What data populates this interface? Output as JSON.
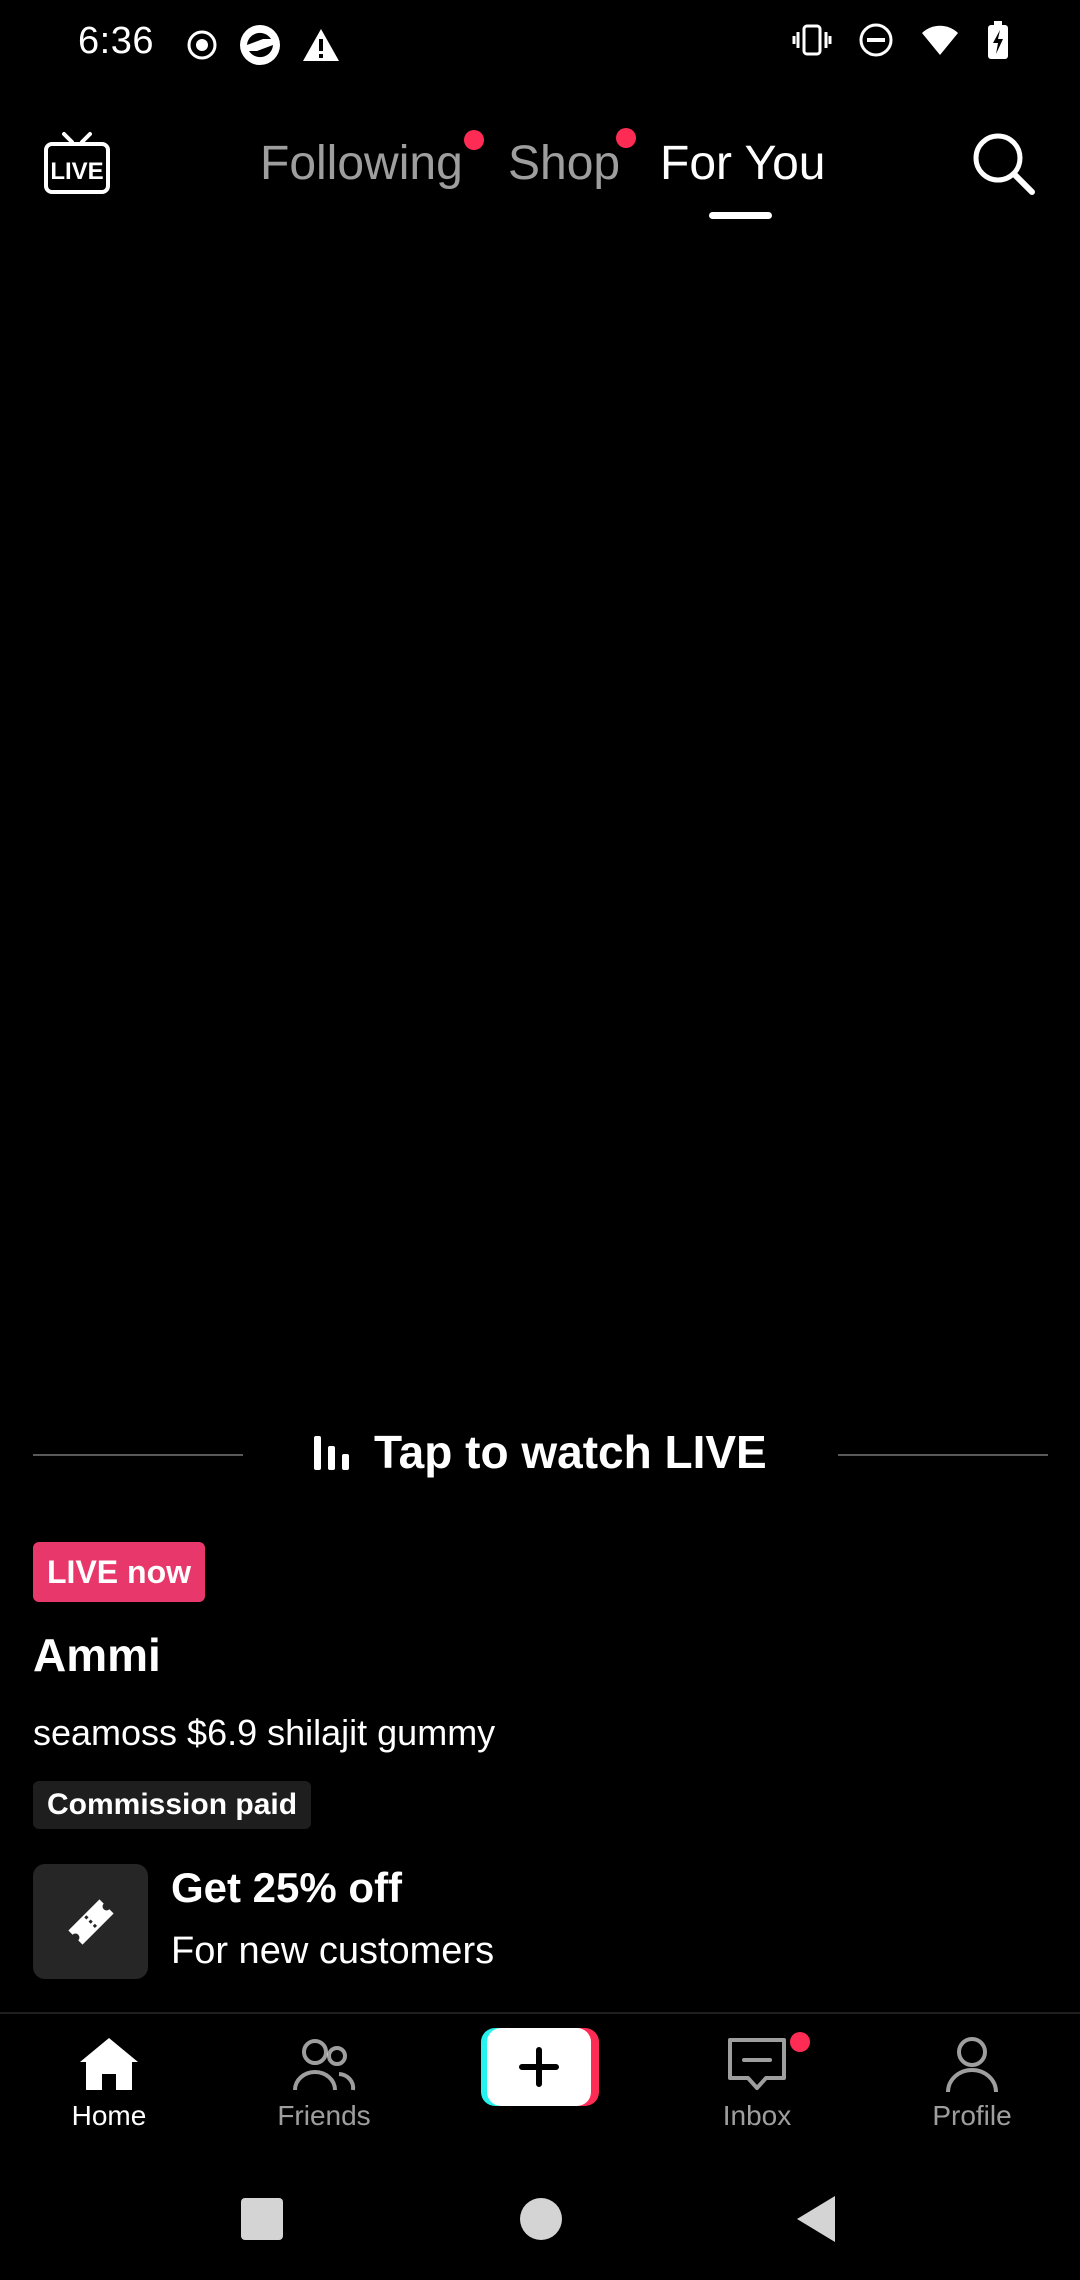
{
  "status_bar": {
    "time": "6:36"
  },
  "top_nav": {
    "live_icon_label": "LIVE",
    "tabs": [
      {
        "label": "Following",
        "has_dot": true,
        "active": false
      },
      {
        "label": "Shop",
        "has_dot": true,
        "active": false
      },
      {
        "label": "For You",
        "has_dot": false,
        "active": true
      }
    ]
  },
  "live": {
    "watch_label": "Tap to watch LIVE",
    "badge": "LIVE now",
    "creator": "Ammi",
    "caption": "seamoss $6.9 shilajit gummy",
    "commission_tag": "Commission paid",
    "promo_title": "Get 25% off",
    "promo_subtitle": "For new customers"
  },
  "bottom_nav": {
    "home": "Home",
    "friends": "Friends",
    "inbox": "Inbox",
    "profile": "Profile"
  },
  "colors": {
    "accent": "#fe2c55",
    "live_badge": "#e8386b",
    "create_cyan": "#25f4ee"
  }
}
